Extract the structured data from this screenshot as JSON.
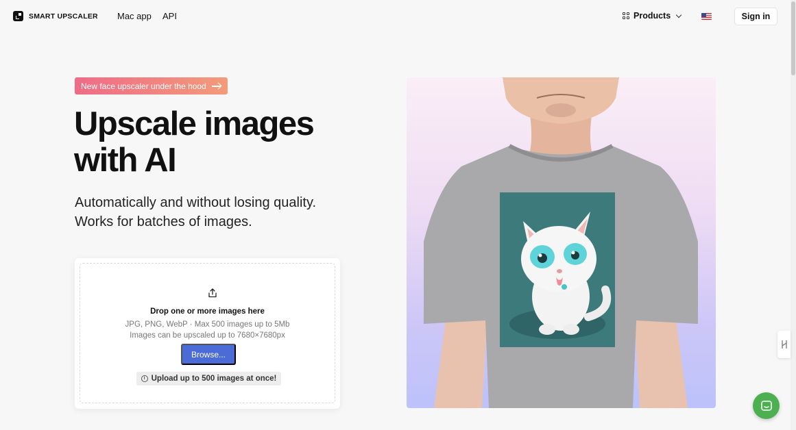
{
  "header": {
    "brand": "SMART UPSCALER",
    "nav": [
      {
        "label": "Mac app"
      },
      {
        "label": "API"
      }
    ],
    "products_label": "Products",
    "signin_label": "Sign in"
  },
  "hero": {
    "badge": "New face upscaler under the hood",
    "headline_line1": "Upscale images",
    "headline_line2": "with AI",
    "sub_line1": "Automatically and without losing quality.",
    "sub_line2": "Works for batches of images."
  },
  "upload": {
    "title": "Drop one or more images here",
    "formats": "JPG, PNG, WebP · Max 500 images up to 5Mb",
    "limit": "Images can be upscaled up to 7680×7680px",
    "browse_label": "Browse...",
    "note": "Upload up to 500 images at once!"
  },
  "colors": {
    "accent": "#4b6bd6",
    "badge_start": "#ef6b87",
    "badge_end": "#f39b7a",
    "chat": "#4caf50"
  }
}
